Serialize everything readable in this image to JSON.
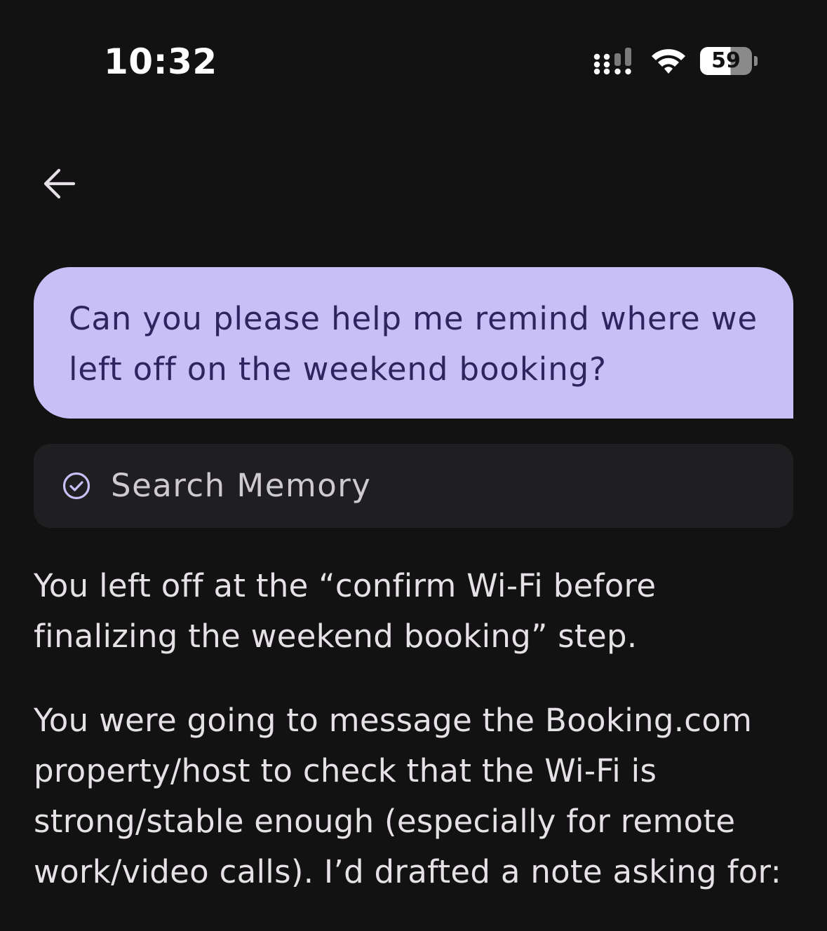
{
  "status_bar": {
    "time": "10:32",
    "battery_level": "59",
    "icons": [
      "signal-icon",
      "wifi-icon",
      "battery-icon"
    ]
  },
  "nav": {
    "back_icon": "arrow-left-icon"
  },
  "conversation": {
    "user_message": "Can you please help me remind where we left off on the weekend booking?",
    "tool_call": {
      "icon": "check-circle-icon",
      "label": "Search Memory"
    },
    "assistant_paragraphs": [
      "You left off at the “confirm Wi-Fi before finalizing the weekend booking” step.",
      "You were going to message the Booking.com property/host to check that the Wi-Fi is strong/stable enough (especially for remote work/video calls). I’d drafted a note asking for:"
    ]
  },
  "colors": {
    "background": "#121212",
    "user_bubble": "#C8BFF7",
    "user_text": "#2E2560",
    "tool_card": "#1F1F21",
    "accent": "#C8BFF7",
    "body_text": "#E6E1E6"
  }
}
